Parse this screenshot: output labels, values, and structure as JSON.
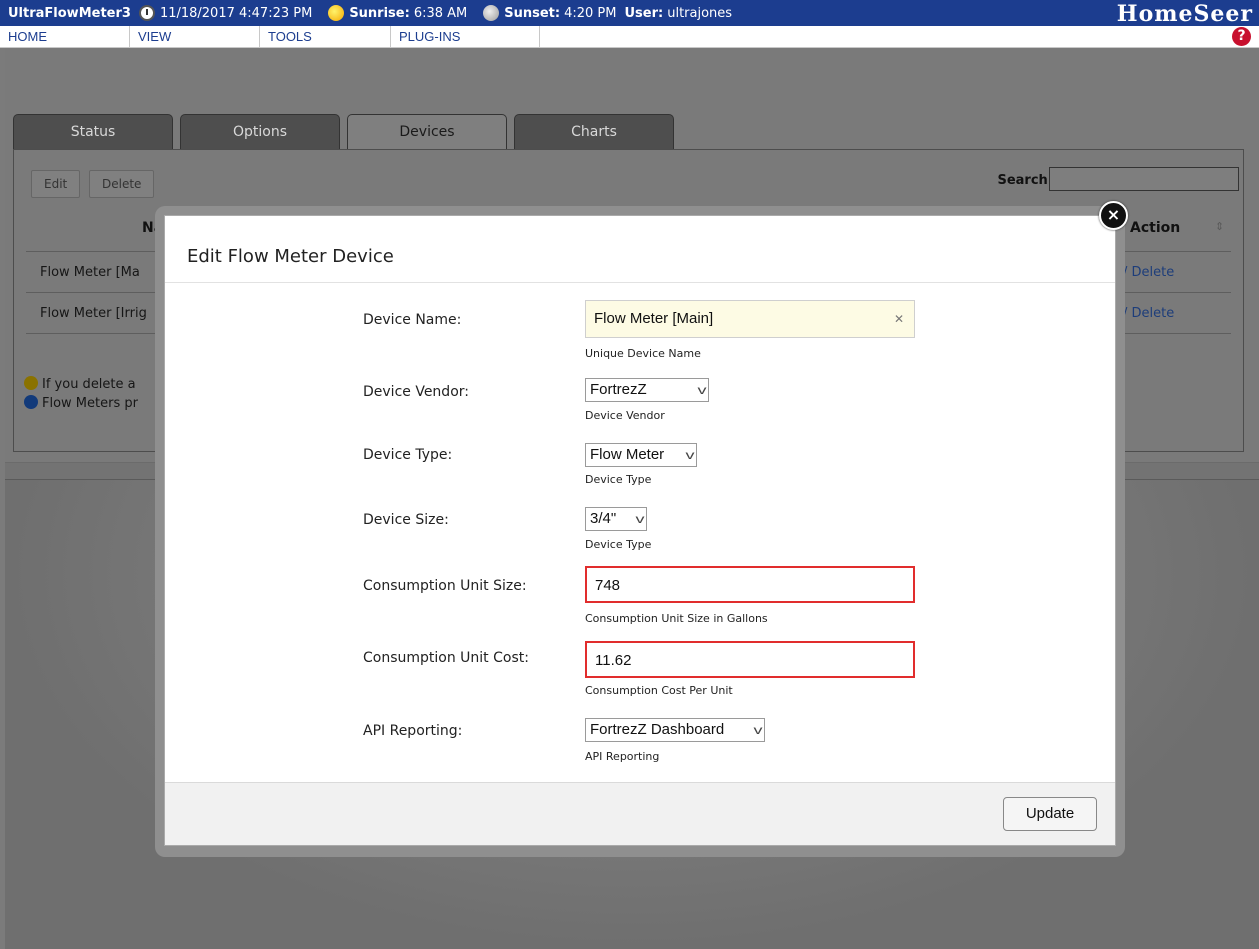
{
  "header": {
    "app_name": "UltraFlowMeter3",
    "datetime": "11/18/2017 4:47:23 PM",
    "sunrise_label": "Sunrise:",
    "sunrise_value": "6:38 AM",
    "sunset_label": "Sunset:",
    "sunset_value": "4:20 PM",
    "user_label": "User:",
    "user_value": "ultrajones",
    "brand": "HomeSeer",
    "help_glyph": "?"
  },
  "nav": {
    "items": [
      {
        "label": "HOME"
      },
      {
        "label": "VIEW"
      },
      {
        "label": "TOOLS"
      },
      {
        "label": "PLUG-INS"
      }
    ]
  },
  "tabs": [
    {
      "label": "Status"
    },
    {
      "label": "Options"
    },
    {
      "label": "Devices"
    },
    {
      "label": "Charts"
    }
  ],
  "toolbar": {
    "edit": "Edit",
    "delete": "Delete",
    "search_label": "Search:"
  },
  "table": {
    "col_name": "Na",
    "col_action": "Action",
    "rows": [
      {
        "name": "Flow Meter [Ma",
        "action": "/ Delete"
      },
      {
        "name": "Flow Meter [Irrig",
        "action": "/ Delete"
      }
    ]
  },
  "notes": {
    "warning": "If you delete a",
    "info": "Flow Meters pr"
  },
  "modal": {
    "title": "Edit Flow Meter Device",
    "close_glyph": "×",
    "fields": {
      "device_name": {
        "label": "Device Name:",
        "value": "Flow Meter [Main]",
        "help": "Unique Device Name"
      },
      "device_vendor": {
        "label": "Device Vendor:",
        "value": "FortrezZ",
        "help": "Device Vendor"
      },
      "device_type": {
        "label": "Device Type:",
        "value": "Flow Meter",
        "help": "Device Type"
      },
      "device_size": {
        "label": "Device Size:",
        "value": "3/4\"",
        "help": "Device Type"
      },
      "unit_size": {
        "label": "Consumption Unit Size:",
        "value": "748",
        "help": "Consumption Unit Size in Gallons"
      },
      "unit_cost": {
        "label": "Consumption Unit Cost:",
        "value": "11.62",
        "help": "Consumption Cost Per Unit"
      },
      "api_reporting": {
        "label": "API Reporting:",
        "value": "FortrezZ Dashboard",
        "help": "API Reporting"
      }
    },
    "update_label": "Update"
  },
  "colors": {
    "header_bg": "#1c3d8f",
    "error_border": "#e12d2d",
    "name_field_bg": "#fdfbe4"
  }
}
